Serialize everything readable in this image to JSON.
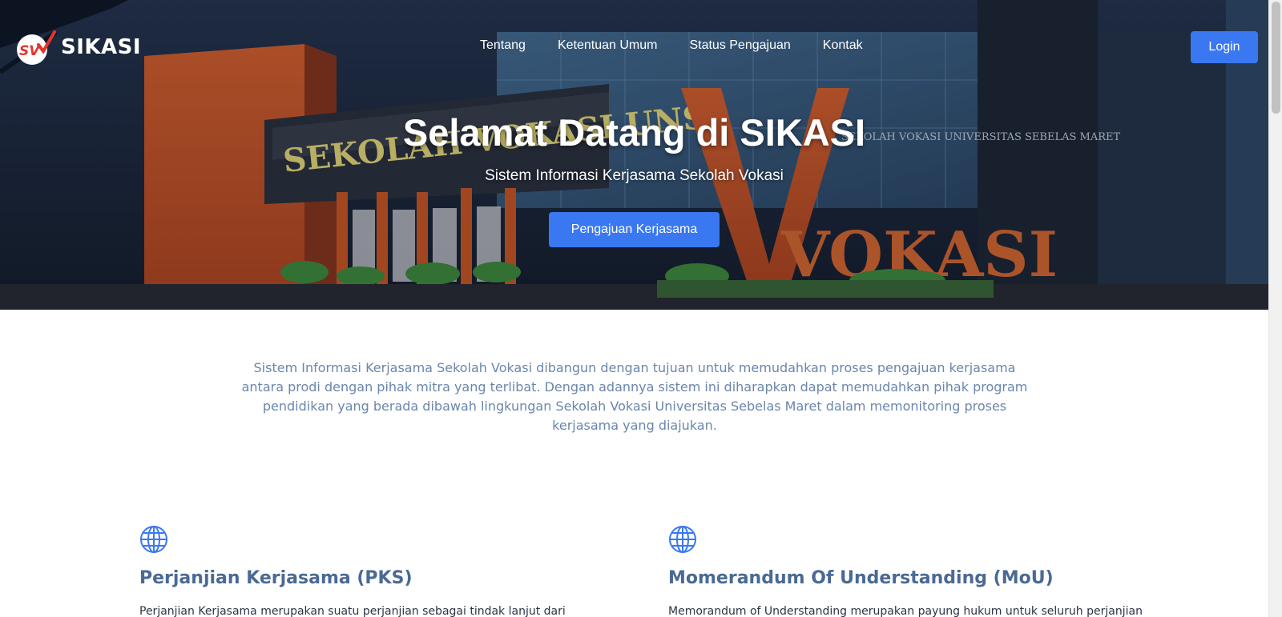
{
  "navbar": {
    "brand_name": "SIKASI",
    "links": [
      "Tentang",
      "Ketentuan Umum",
      "Status Pengajuan",
      "Kontak"
    ],
    "login_label": "Login"
  },
  "hero": {
    "title": "Selamat Datang di SIKASI",
    "subtitle": "Sistem Informasi Kerjasama Sekolah Vokasi",
    "cta_label": "Pengajuan Kerjasama",
    "scene_sign_left": "SEKOLAH VOKASI UNS",
    "scene_sign_right": "VOKASI",
    "scene_plaque": "SEKOLAH VOKASI UNIVERSITAS SEBELAS MARET"
  },
  "intro": {
    "text": "Sistem Informasi Kerjasama Sekolah Vokasi dibangun dengan tujuan untuk memudahkan proses pengajuan kerjasama antara prodi dengan pihak mitra yang terlibat. Dengan adannya sistem ini diharapkan dapat memudahkan pihak program pendidikan yang berada dibawah lingkungan Sekolah Vokasi Universitas Sebelas Maret dalam memonitoring proses kerjasama yang diajukan."
  },
  "features": [
    {
      "icon": "globe-icon",
      "title": "Perjanjian Kerjasama (PKS)",
      "text": "Perjanjian Kerjasama merupakan suatu perjanjian sebagai tindak lanjut dari"
    },
    {
      "icon": "globe-icon",
      "title": "Momerandum Of Understanding (MoU)",
      "text": "Memorandum of Understanding merupakan payung hukum untuk seluruh perjanjian"
    }
  ],
  "colors": {
    "accent": "#3a78f2",
    "intro_text": "#6a86ad",
    "feature_title": "#4a6a94"
  }
}
